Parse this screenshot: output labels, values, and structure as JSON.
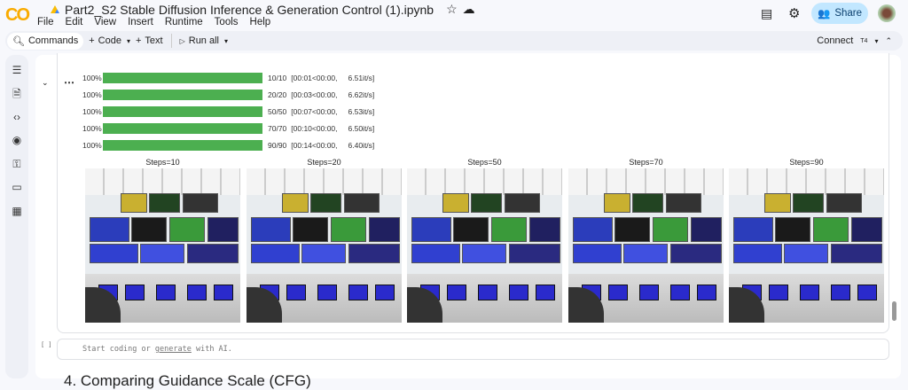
{
  "app": {
    "logo": "CO",
    "title": "Part2_S2 Stable Diffusion Inference & Generation Control (1).ipynb",
    "share": "Share"
  },
  "menu": [
    "File",
    "Edit",
    "View",
    "Insert",
    "Runtime",
    "Tools",
    "Help"
  ],
  "toolbar": {
    "commands": "Commands",
    "code": "Code",
    "text": "Text",
    "run_all": "Run all",
    "connect": "Connect",
    "runtime": "T4"
  },
  "progress": [
    {
      "pct": "100%",
      "value": 1.0,
      "count": "10/10",
      "time": "[00:01<00:00,",
      "rate": "6.51it/s]"
    },
    {
      "pct": "100%",
      "value": 1.0,
      "count": "20/20",
      "time": "[00:03<00:00,",
      "rate": "6.62it/s]"
    },
    {
      "pct": "100%",
      "value": 1.0,
      "count": "50/50",
      "time": "[00:07<00:00,",
      "rate": "6.53it/s]"
    },
    {
      "pct": "100%",
      "value": 1.0,
      "count": "70/70",
      "time": "[00:10<00:00,",
      "rate": "6.50it/s]"
    },
    {
      "pct": "100%",
      "value": 1.0,
      "count": "90/90",
      "time": "[00:14<00:00,",
      "rate": "6.40it/s]"
    }
  ],
  "images": [
    "Steps=10",
    "Steps=20",
    "Steps=50",
    "Steps=70",
    "Steps=90"
  ],
  "empty_cell": {
    "bracket": "[ ]",
    "pre": "Start coding or ",
    "link": "generate",
    "post": " with AI."
  },
  "next_heading": "4. Comparing Guidance Scale (CFG)",
  "colors": {
    "accent": "#4caf50",
    "share_bg": "#c2e7ff"
  }
}
